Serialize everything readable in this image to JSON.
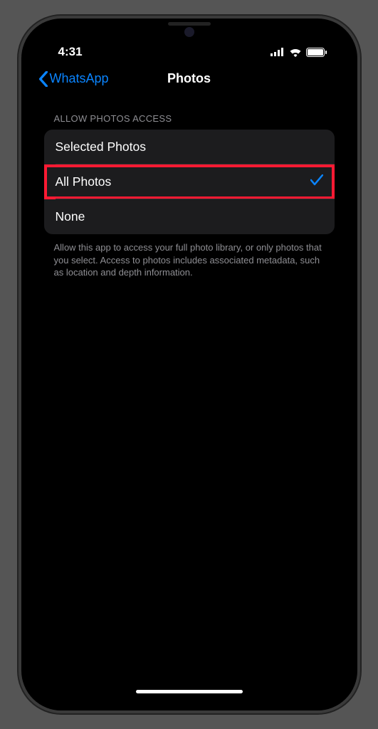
{
  "statusBar": {
    "time": "4:31"
  },
  "nav": {
    "back": "WhatsApp",
    "title": "Photos"
  },
  "section": {
    "header": "ALLOW PHOTOS ACCESS",
    "options": {
      "selected": "Selected Photos",
      "all": "All Photos",
      "none": "None"
    },
    "footer": "Allow this app to access your full photo library, or only photos that you select. Access to photos includes associated metadata, such as location and depth information."
  }
}
